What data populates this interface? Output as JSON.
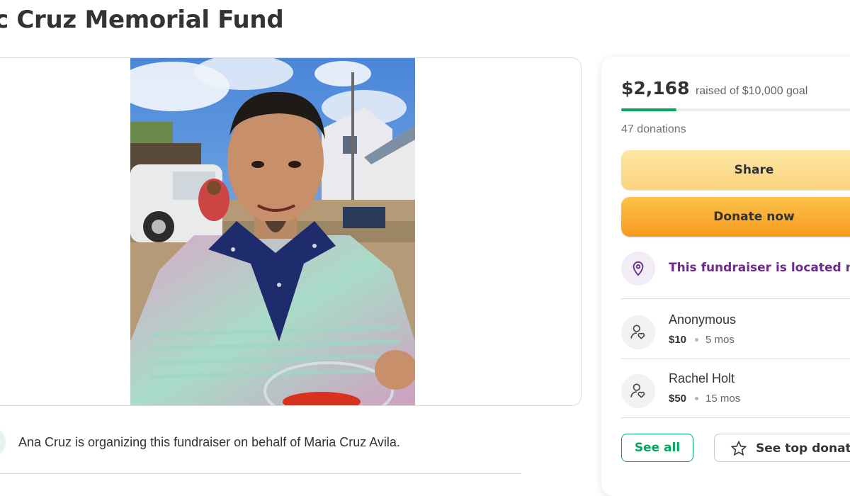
{
  "campaign": {
    "title": "c Cruz Memorial Fund",
    "organizer_text": "Ana Cruz is organizing this fundraiser on behalf of Maria Cruz Avila."
  },
  "donation_panel": {
    "raised_amount": "$2,168",
    "goal_text": "raised of $10,000 goal",
    "progress_fraction": 0.2168,
    "donation_count": "47 donations",
    "share_label": "Share",
    "donate_label": "Donate now",
    "location_text": "This fundraiser is located nea",
    "donors": [
      {
        "name": "Anonymous",
        "amount": "$10",
        "time": "5 mos"
      },
      {
        "name": "Rachel Holt",
        "amount": "$50",
        "time": "15 mos"
      }
    ],
    "see_all_label": "See all",
    "see_top_label": "See top donati"
  },
  "colors": {
    "brand_green": "#02a95c",
    "donate_orange": "#f79a1e",
    "share_yellow": "#fbd27c",
    "location_purple": "#6b2a8c"
  },
  "icons": [
    "location-pin-icon",
    "donor-heart-icon",
    "star-icon"
  ]
}
